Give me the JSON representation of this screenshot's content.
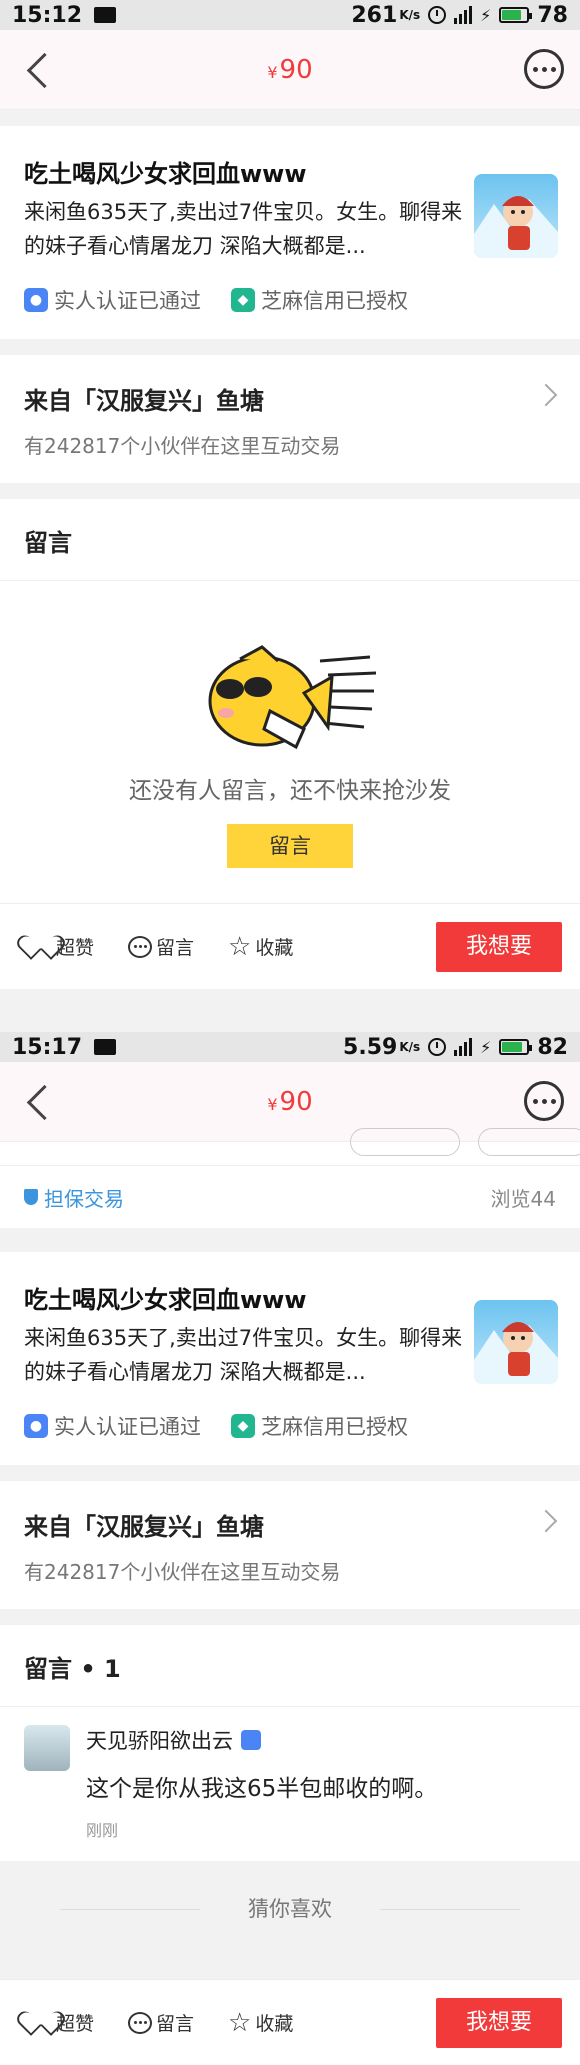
{
  "screens": [
    {
      "status": {
        "time": "15:12",
        "speed": "261",
        "speed_unit": "K/s",
        "battery": "78"
      },
      "nav": {
        "currency": "¥",
        "price": "90"
      },
      "seller": {
        "name": "吃土喝风少女求回血www",
        "bio": "来闲鱼635天了,卖出过7件宝贝。女生。聊得来的妹子看心情屠龙刀 深陷大概都是...",
        "badge_real": "实人认证已通过",
        "badge_sesame": "芝麻信用已授权"
      },
      "pond": {
        "title": "来自「汉服复兴」鱼塘",
        "subtitle": "有242817个小伙伴在这里互动交易"
      },
      "comments": {
        "title": "留言",
        "empty_text": "还没有人留言，还不快来抢沙发",
        "button": "留言"
      },
      "bottom": {
        "like": "超赞",
        "comment": "留言",
        "favorite": "收藏",
        "want": "我想要"
      }
    },
    {
      "status": {
        "time": "15:17",
        "speed": "5.59",
        "speed_unit": "K/s",
        "battery": "82"
      },
      "nav": {
        "currency": "¥",
        "price": "90"
      },
      "trade": {
        "secure": "担保交易",
        "views": "浏览44"
      },
      "seller": {
        "name": "吃土喝风少女求回血www",
        "bio": "来闲鱼635天了,卖出过7件宝贝。女生。聊得来的妹子看心情屠龙刀 深陷大概都是...",
        "badge_real": "实人认证已通过",
        "badge_sesame": "芝麻信用已授权"
      },
      "pond": {
        "title": "来自「汉服复兴」鱼塘",
        "subtitle": "有242817个小伙伴在这里互动交易"
      },
      "comments": {
        "title": "留言 • 1",
        "items": [
          {
            "user": "天见骄阳欲出云",
            "text": "这个是你从我这65半包邮收的啊。",
            "time": "刚刚"
          }
        ]
      },
      "guess": "猜你喜欢",
      "bottom": {
        "like": "超赞",
        "comment": "留言",
        "favorite": "收藏",
        "want": "我想要"
      }
    }
  ],
  "colors": {
    "price": "#f23a3a",
    "want_button": "#f23a3a",
    "comment_button": "#ffd43b",
    "secure": "#3b94dd"
  }
}
